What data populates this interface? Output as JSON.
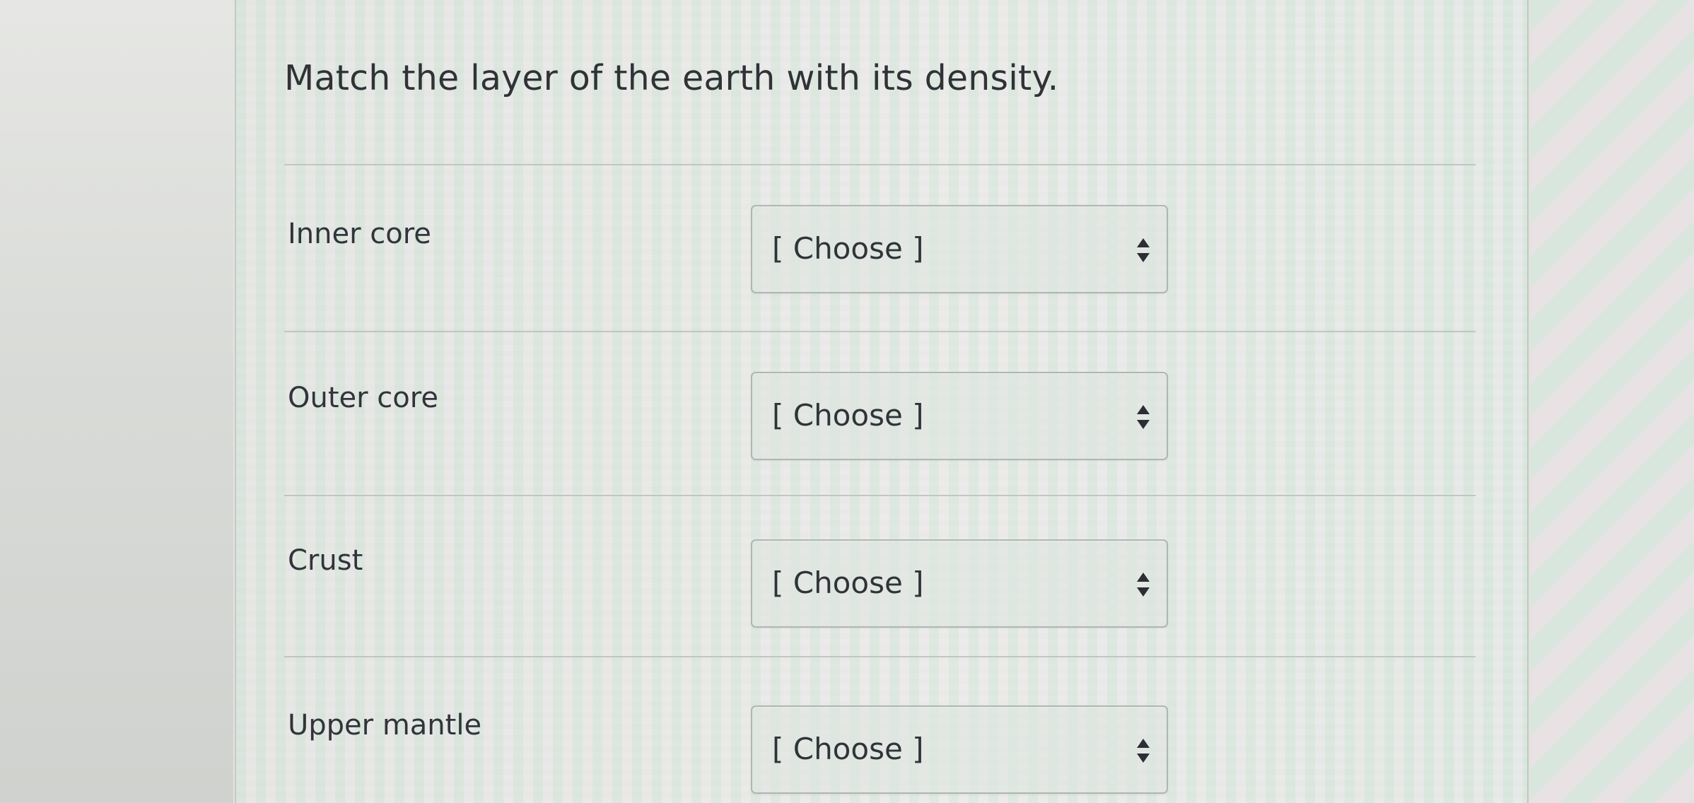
{
  "question": {
    "prompt": "Match the layer of the earth with its density."
  },
  "answers": [
    {
      "term": "Inner core",
      "selected": "[ Choose ]"
    },
    {
      "term": "Outer core",
      "selected": "[ Choose ]"
    },
    {
      "term": "Crust",
      "selected": "[ Choose ]"
    },
    {
      "term": "Upper mantle",
      "selected": "[ Choose ]"
    }
  ],
  "icons": {
    "select": "up-down-chevron-icon"
  },
  "colors": {
    "text": "#2f3336",
    "divider": "#b8c1bc",
    "select_border": "#aeb7b2",
    "card_tint": "#e9ece8"
  }
}
